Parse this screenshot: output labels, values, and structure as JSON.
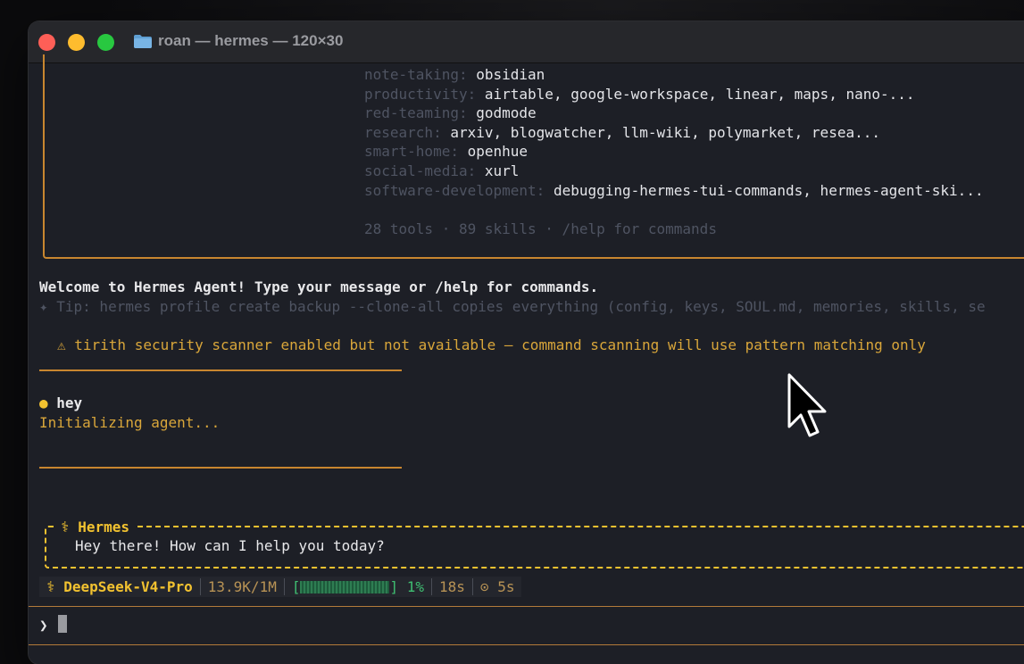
{
  "window": {
    "title": "roan — hermes — 120×30"
  },
  "skills": [
    {
      "category": "note-taking:",
      "items": "obsidian"
    },
    {
      "category": "productivity:",
      "items": "airtable, google-workspace, linear, maps, nano-..."
    },
    {
      "category": "red-teaming:",
      "items": "godmode"
    },
    {
      "category": "research:",
      "items": "arxiv, blogwatcher, llm-wiki, polymarket, resea..."
    },
    {
      "category": "smart-home:",
      "items": "openhue"
    },
    {
      "category": "social-media:",
      "items": "xurl"
    },
    {
      "category": "software-development:",
      "items": "debugging-hermes-tui-commands, hermes-agent-ski..."
    }
  ],
  "summary": "28 tools · 89 skills · /help for commands",
  "welcome": "Welcome to Hermes Agent! Type your message or /help for commands.",
  "tip": "✦ Tip: hermes profile create backup --clone-all copies everything (config, keys, SOUL.md, memories, skills, se",
  "warning": "⚠ tirith security scanner enabled but not available — command scanning will use pattern matching only",
  "user_message": {
    "bullet": "●",
    "text": "hey"
  },
  "status_text": "Initializing agent...",
  "assistant": {
    "name": "⚕ Hermes",
    "message": "Hey there! How can I help you today?"
  },
  "statusbar": {
    "model": "⚕ DeepSeek-V4-Pro",
    "tokens": "13.9K/1M",
    "bar_open": "[",
    "bar_close": "]",
    "context_percent": "1%",
    "context_fraction": 0.01,
    "elapsed": "18s",
    "timer": "⊙ 5s"
  },
  "prompt": {
    "symbol": "❯"
  }
}
